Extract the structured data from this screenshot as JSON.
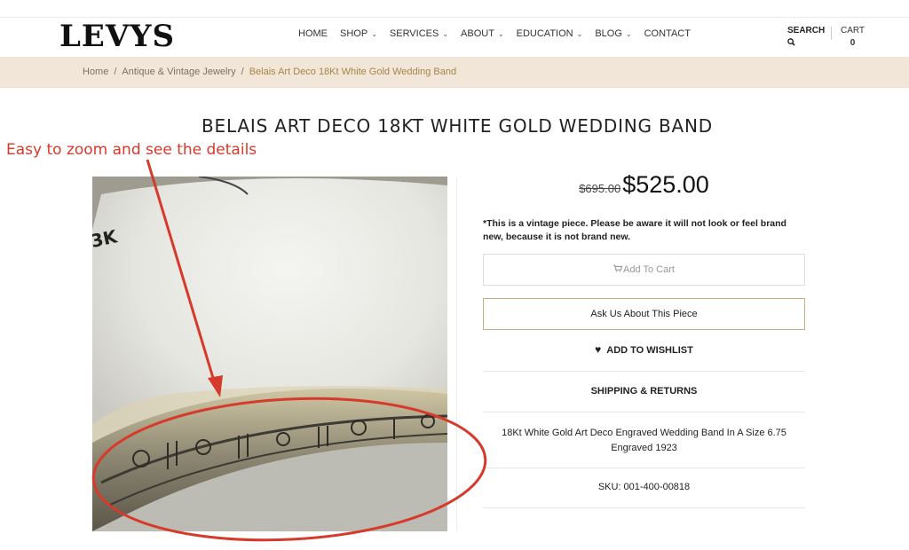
{
  "brand": {
    "logo": "LEVYS"
  },
  "nav": {
    "items": [
      {
        "label": "HOME",
        "has_dropdown": false
      },
      {
        "label": "SHOP",
        "has_dropdown": true
      },
      {
        "label": "SERVICES",
        "has_dropdown": true
      },
      {
        "label": "ABOUT",
        "has_dropdown": true
      },
      {
        "label": "EDUCATION",
        "has_dropdown": true
      },
      {
        "label": "BLOG",
        "has_dropdown": true
      },
      {
        "label": "CONTACT",
        "has_dropdown": false
      }
    ],
    "search_label": "SEARCH",
    "cart_label": "CART",
    "cart_count": "0"
  },
  "breadcrumb": {
    "items": [
      "Home",
      "Antique & Vintage Jewelry",
      "Belais Art Deco 18Kt White Gold Wedding Band"
    ],
    "separator": "/"
  },
  "product": {
    "title": "BELAIS ART DECO 18KT WHITE GOLD WEDDING BAND",
    "old_price": "$695.00",
    "price": "$525.00",
    "notice": "*This is a vintage piece. Please be aware it will not look or feel brand new, because it is not brand new.",
    "add_to_cart": "Add To Cart",
    "ask_button": "Ask Us About This Piece",
    "wishlist": "ADD TO WISHLIST",
    "shipping": "SHIPPING & RETURNS",
    "description": "18Kt White Gold Art Deco Engraved Wedding Band In A Size 6.75 Engraved 1923",
    "sku": "SKU: 001-400-00818"
  },
  "annotation": {
    "text": "Easy to zoom and see the details",
    "color": "#d63a2a"
  },
  "photo": {
    "engraving": "3K"
  },
  "colors": {
    "breadcrumb_bg": "#f1e6d7",
    "accent_border": "#c8ad7f",
    "annotation": "#d63a2a"
  }
}
